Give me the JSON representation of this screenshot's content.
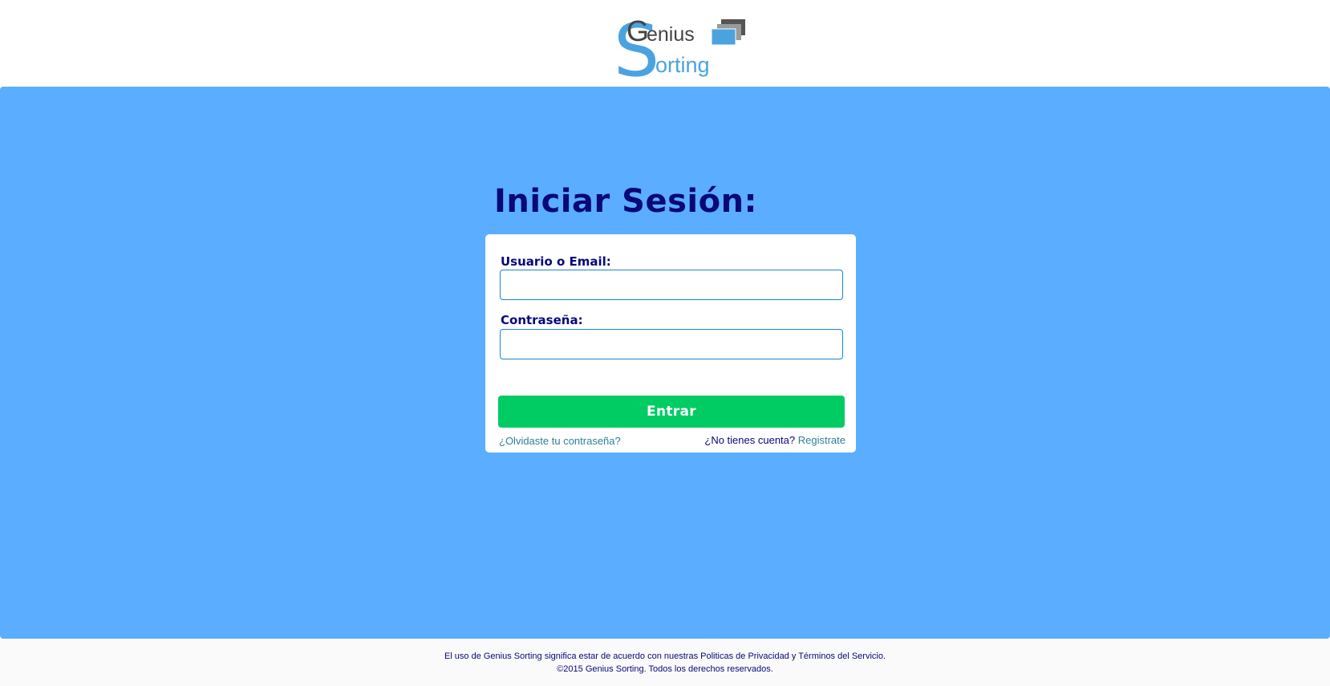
{
  "brand": {
    "logo_word_1": "Genius",
    "logo_word_2": "Sorting",
    "colors": {
      "logo_blue": "#4aa3df",
      "logo_dark": "#444444",
      "hero_background": "#5badff",
      "heading": "#08087a",
      "button": "#00cc63",
      "link": "#2f7f97",
      "input_border": "#1a86c9"
    }
  },
  "login": {
    "title": "Iniciar Sesión:",
    "username_label": "Usuario o Email:",
    "username_value": "",
    "password_label": "Contraseña:",
    "password_value": "",
    "submit_label": "Entrar",
    "forgot_link": "¿Olvidaste tu contraseña?",
    "no_account_text": "¿No tienes cuenta? ",
    "register_link": "Registrate"
  },
  "footer": {
    "line1": "El uso de Genius Sorting significa estar de acuerdo con nuestras Politicas de Privacidad y Términos del Servicio.",
    "line2": "©2015 Genius Sorting. Todos los derechos reservados."
  }
}
